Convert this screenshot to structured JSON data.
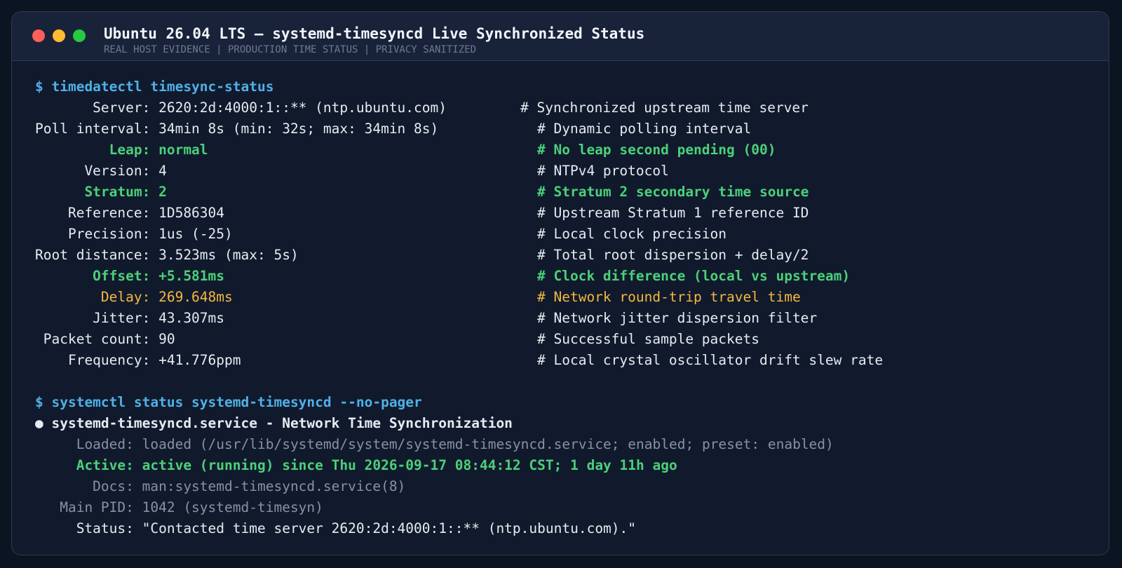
{
  "window": {
    "title": "Ubuntu 26.04 LTS — systemd-timesyncd Live Synchronized Status",
    "subtitle": "REAL HOST EVIDENCE | PRODUCTION TIME STATUS | PRIVACY SANITIZED"
  },
  "timesync": {
    "command": "$ timedatectl timesync-status",
    "server": {
      "text": "       Server: 2620:2d:4000:1::** (ntp.ubuntu.com)",
      "comment": "# Synchronized upstream time server"
    },
    "poll": {
      "text": "Poll interval: 34min 8s (min: 32s; max: 34min 8s)",
      "comment": "# Dynamic polling interval"
    },
    "leap": {
      "text": "         Leap: normal",
      "comment": "# No leap second pending (00)"
    },
    "version": {
      "text": "      Version: 4",
      "comment": "# NTPv4 protocol"
    },
    "stratum": {
      "text": "      Stratum: 2",
      "comment": "# Stratum 2 secondary time source"
    },
    "reference": {
      "text": "    Reference: 1D586304",
      "comment": "# Upstream Stratum 1 reference ID"
    },
    "precision": {
      "text": "    Precision: 1us (-25)",
      "comment": "# Local clock precision"
    },
    "root_distance": {
      "text": "Root distance: 3.523ms (max: 5s)",
      "comment": "# Total root dispersion + delay/2"
    },
    "offset": {
      "text": "       Offset: +5.581ms",
      "comment": "# Clock difference (local vs upstream)"
    },
    "delay": {
      "text": "        Delay: 269.648ms",
      "comment": "# Network round-trip travel time"
    },
    "jitter": {
      "text": "       Jitter: 43.307ms",
      "comment": "# Network jitter dispersion filter"
    },
    "packet_count": {
      "text": " Packet count: 90",
      "comment": "# Successful sample packets"
    },
    "frequency": {
      "text": "    Frequency: +41.776ppm",
      "comment": "# Local crystal oscillator drift slew rate"
    }
  },
  "service": {
    "command": "$ systemctl status systemd-timesyncd --no-pager",
    "header": "● systemd-timesyncd.service - Network Time Synchronization",
    "loaded": "     Loaded: loaded (/usr/lib/systemd/system/systemd-timesyncd.service; enabled; preset: enabled)",
    "active": "     Active: active (running) since Thu 2026-09-17 08:44:12 CST; 1 day 11h ago",
    "docs": "       Docs: man:systemd-timesyncd.service(8)",
    "pid": "   Main PID: 1042 (systemd-timesyn)",
    "status": "     Status: \"Contacted time server 2620:2d:4000:1::** (ntp.ubuntu.com).\""
  },
  "colors": {
    "command": "#4fb0e8",
    "ok": "#4cd07a",
    "warn": "#f4b740",
    "dim": "#8592a6"
  }
}
